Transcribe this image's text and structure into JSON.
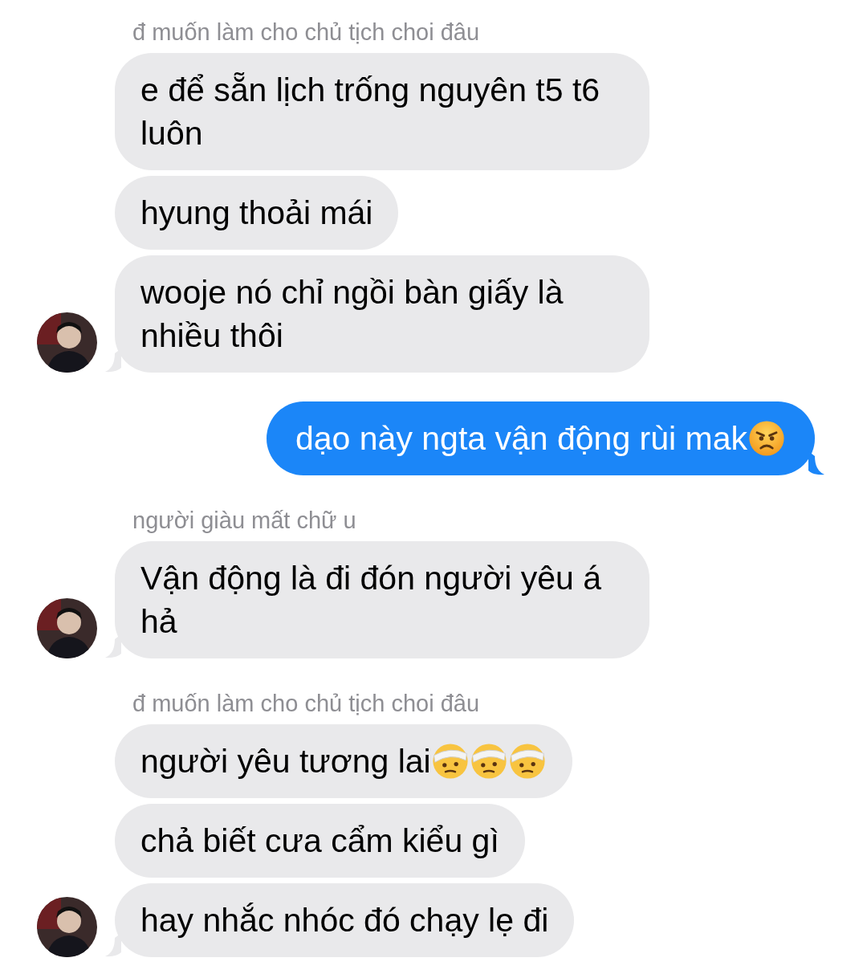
{
  "messages": [
    {
      "kind": "sender",
      "text": "đ muốn làm cho chủ tịch choi đâu"
    },
    {
      "kind": "incoming",
      "text": "e để sẵn lịch trống nguyên t5 t6 luôn",
      "avatar": false
    },
    {
      "kind": "incoming",
      "text": "hyung thoải mái",
      "avatar": false
    },
    {
      "kind": "incoming",
      "text": "wooje nó chỉ ngồi bàn giấy là nhiều thôi",
      "avatar": true
    },
    {
      "kind": "outgoing",
      "text": "dạo này ngta vận động rùi mak",
      "icons": [
        {
          "kind": "angry"
        }
      ]
    },
    {
      "kind": "sender",
      "text": "người giàu mất chữ u"
    },
    {
      "kind": "incoming",
      "text": "Vận động là đi đón người yêu á hả",
      "avatar": true
    },
    {
      "kind": "sender",
      "text": "đ muốn làm cho chủ tịch choi đâu"
    },
    {
      "kind": "incoming",
      "text": "người yêu tương lai",
      "avatar": false,
      "icons": [
        {
          "kind": "bandaged"
        },
        {
          "kind": "bandaged"
        },
        {
          "kind": "bandaged"
        }
      ]
    },
    {
      "kind": "incoming",
      "text": "chả biết cưa cẩm kiểu gì",
      "avatar": false
    },
    {
      "kind": "incoming",
      "text": "hay nhắc nhóc đó chạy lẹ đi",
      "avatar": true
    }
  ]
}
